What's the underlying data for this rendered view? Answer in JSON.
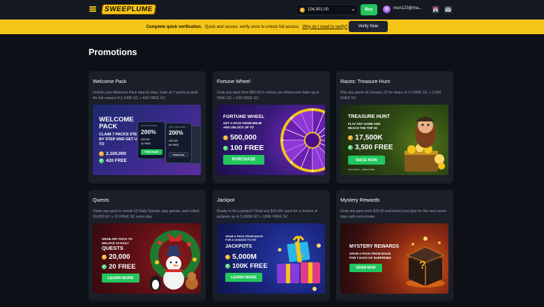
{
  "header": {
    "logo": "SWEEPLUME",
    "balance": "104,901.00",
    "balance_chevron": "▾",
    "buy_label": "Buy",
    "username": "muri123@ma...",
    "store_icon": "store-icon",
    "mail_icon": "mail-icon"
  },
  "banner": {
    "bold": "Complete quick verification.",
    "text": "Quick and secure, verify once to unlock full access.",
    "link": "Why do I need to verify?",
    "button": "Verify Now"
  },
  "page": {
    "title": "Promotions"
  },
  "cards": [
    {
      "title": "Welcome Pack",
      "desc": "Unlock your Welcome Pack step by step. Grab all 7 packs to grab the full reward of 2,100K GC + 420 FREE SC.",
      "art": {
        "headline": "WELCOME PACK",
        "sub": "CLAIM 7 PACKS STEP BY STEP AND GET UP TO",
        "gc": "2,100,000",
        "sc": "420 FREE",
        "pct1": "200%",
        "pct2": "200%",
        "mini1": "200,000",
        "mini2": "40 FREE",
        "mini3": "400,000",
        "mini4": "80 FREE",
        "btn1": "PURCHASE",
        "btn2": "PURCHASE",
        "tag1": "1ST PURCHASE",
        "tag2": "2ND PURCHASE"
      }
    },
    {
      "title": "Fortune Wheel",
      "desc": "Grab any pack from $99.99 to unlock you wheel and claim up to 500K GC + 100 FREE SC.",
      "art": {
        "headline": "FORTUNE WHEEL",
        "sub": "GET A PACK FROM $99.99 AND UNLOCK UP TO",
        "gc": "500,000",
        "sc": "100 FREE",
        "btn": "PURCHASE"
      }
    },
    {
      "title": "Races: Treasure Hunt",
      "desc": "Play any game till January 22 for share of 17,500K GC + 3,500 FREE SC.",
      "art": {
        "headline": "TREASURE HUNT",
        "sub": "PLAY ANY GAME AND REACH THE TOP 30",
        "gc": "17,500K",
        "sc": "3,500 FREE",
        "btn": "RACE NOW",
        "fine": "T&CS APPLY · SWEEPLUME"
      }
    },
    {
      "title": "Quests",
      "desc": "Claim any pack to unlock 10 Daily Quests, play games, and collect 20,000 GC + 20 FREE SC every day.",
      "art": {
        "sub": "GRAB ANY PACK TO UNLOCK 10 DAILY",
        "headline": "QUESTS",
        "gc": "20,000",
        "sc": "20 FREE",
        "btn": "LEARN MORE"
      }
    },
    {
      "title": "Jackpot",
      "desc": "Ready to hit a jackpot? Grab any $19.99+ pack for a chance at jackpots up to 5,000M GC + 100K FREE SC.",
      "art": {
        "sub": "GRAB A PACK FROM $19.99 FOR A CHANCE TO HIT",
        "headline": "JACKPOTS",
        "gc": "5,000M",
        "sc": "100K FREE",
        "btn": "LEARN MORE",
        "jp": "JP"
      }
    },
    {
      "title": "Mystery Rewards",
      "desc": "Grab any pack from $15.00 and boost your play for the next seven days with extra treats.",
      "art": {
        "headline": "MYSTERY REWARDS",
        "sub": "GRAB A PACK FROM $15.00 FOR 7 DAYS OF SURPRISES",
        "btn": "GRAB NOW",
        "q": "?"
      }
    }
  ],
  "colors": {
    "accent": "#f5c518",
    "green": "#22c55e",
    "card": "#1a1f29",
    "bg": "#0d1117"
  }
}
